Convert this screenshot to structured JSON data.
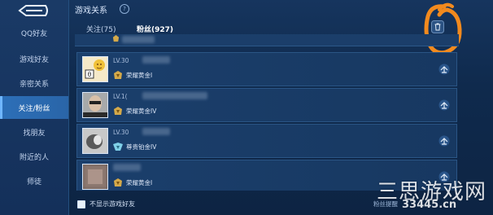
{
  "sidebar": {
    "items": [
      {
        "label": "QQ好友"
      },
      {
        "label": "游戏好友"
      },
      {
        "label": "亲密关系"
      },
      {
        "label": "关注/粉丝",
        "active": true
      },
      {
        "label": "找朋友"
      },
      {
        "label": "附近的人"
      },
      {
        "label": "师徒"
      }
    ]
  },
  "header": {
    "title": "游戏关系",
    "help_symbol": "?"
  },
  "tabs": [
    {
      "label": "关注(75)"
    },
    {
      "label": "粉丝(927)",
      "active": true
    }
  ],
  "rows": [
    {
      "level": "LV.30",
      "rank": "荣耀黄金I",
      "rank_color": "#d4a94a"
    },
    {
      "level": "LV.1(",
      "rank": "荣耀黄金IV",
      "rank_color": "#d4a94a"
    },
    {
      "level": "LV.30",
      "rank": "尊贵铂金IV",
      "rank_color": "#7fd0e8"
    },
    {
      "level": "",
      "rank": "荣耀黄金I",
      "rank_color": "#d4a94a"
    }
  ],
  "footer": {
    "checkbox_label": "不显示游戏好友",
    "right_label": "粉丝提醒"
  },
  "watermark": {
    "big": "三思游戏网",
    "small": "33445.cn"
  },
  "colors": {
    "accent": "#6fb6ff",
    "annotation": "#f28a1e"
  }
}
